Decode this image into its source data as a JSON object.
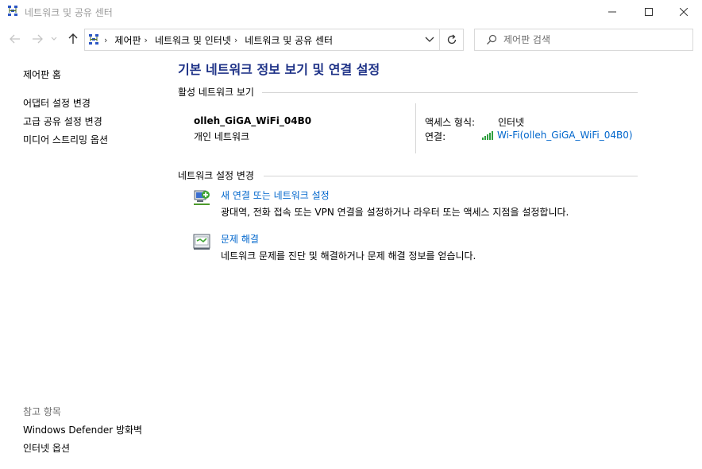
{
  "window": {
    "title": "네트워크 및 공유 센터"
  },
  "navigation": {
    "breadcrumbs": [
      "제어판",
      "네트워크 및 인터넷",
      "네트워크 및 공유 센터"
    ],
    "search_placeholder": "제어판 검색"
  },
  "sidebar": {
    "home_label": "제어판 홈",
    "items": [
      {
        "label": "어댑터 설정 변경"
      },
      {
        "label": "고급 공유 설정 변경"
      },
      {
        "label": "미디어 스트리밍 옵션"
      }
    ],
    "see_also_header": "참고 항목",
    "see_also": [
      {
        "label": "Windows Defender 방화벽"
      },
      {
        "label": "인터넷 옵션"
      }
    ]
  },
  "main": {
    "title": "기본 네트워크 정보 보기 및 연결 설정",
    "active_networks": {
      "header": "활성 네트워크 보기",
      "network_name": "olleh_GiGA_WiFi_04B0",
      "network_type": "개인 네트워크",
      "access_type_label": "액세스 형식:",
      "access_type_value": "인터넷",
      "connections_label": "연결:",
      "connection_link": "Wi-Fi(olleh_GiGA_WiFi_04B0)"
    },
    "change_settings": {
      "header": "네트워크 설정 변경",
      "tasks": [
        {
          "link": "새 연결 또는 네트워크 설정",
          "description": "광대역, 전화 접속 또는 VPN 연결을 설정하거나 라우터 또는 액세스 지점을 설정합니다."
        },
        {
          "link": "문제 해결",
          "description": "네트워크 문제를 진단 및 해결하거나 문제 해결 정보를 얻습니다."
        }
      ]
    }
  },
  "colors": {
    "title_blue": "#1e3287",
    "link_blue": "#0066cc",
    "signal_green": "#2e9e3e"
  },
  "icons": {
    "app": "network-sharing-icon",
    "back": "arrow-left-icon",
    "forward": "arrow-right-icon",
    "up": "arrow-up-icon",
    "refresh": "refresh-icon",
    "search": "search-icon",
    "signal": "wifi-signal-icon"
  }
}
